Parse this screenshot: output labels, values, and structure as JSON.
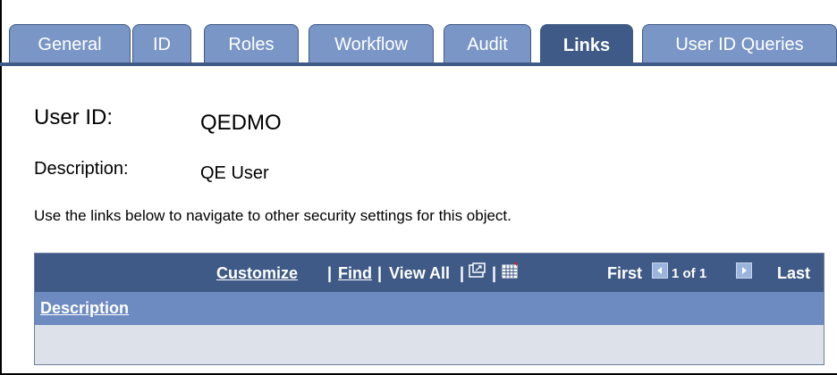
{
  "tabs": [
    {
      "label": "General",
      "active": false
    },
    {
      "label": "ID",
      "active": false
    },
    {
      "label": "Roles",
      "active": false
    },
    {
      "label": "Workflow",
      "active": false
    },
    {
      "label": "Audit",
      "active": false
    },
    {
      "label": "Links",
      "active": true
    },
    {
      "label": "User ID Queries",
      "active": false
    }
  ],
  "form": {
    "user_id_label": "User ID:",
    "user_id_value": "QEDMO",
    "description_label": "Description:",
    "description_value": "QE User",
    "instructions": "Use the links below to navigate to other security settings for this object."
  },
  "grid": {
    "customize": "Customize",
    "separator": "|",
    "find": "Find",
    "view_all": "View All",
    "first": "First",
    "page_count": "1 of 1",
    "last": "Last",
    "column_header": "Description",
    "icons": {
      "new_window": "new-window-icon",
      "download": "spreadsheet-icon",
      "prev": "previous-arrow-icon",
      "next": "next-arrow-icon"
    },
    "colors": {
      "toolbar": "#3f5a86",
      "header": "#6d8bc1",
      "row": "#dde2ea"
    }
  }
}
